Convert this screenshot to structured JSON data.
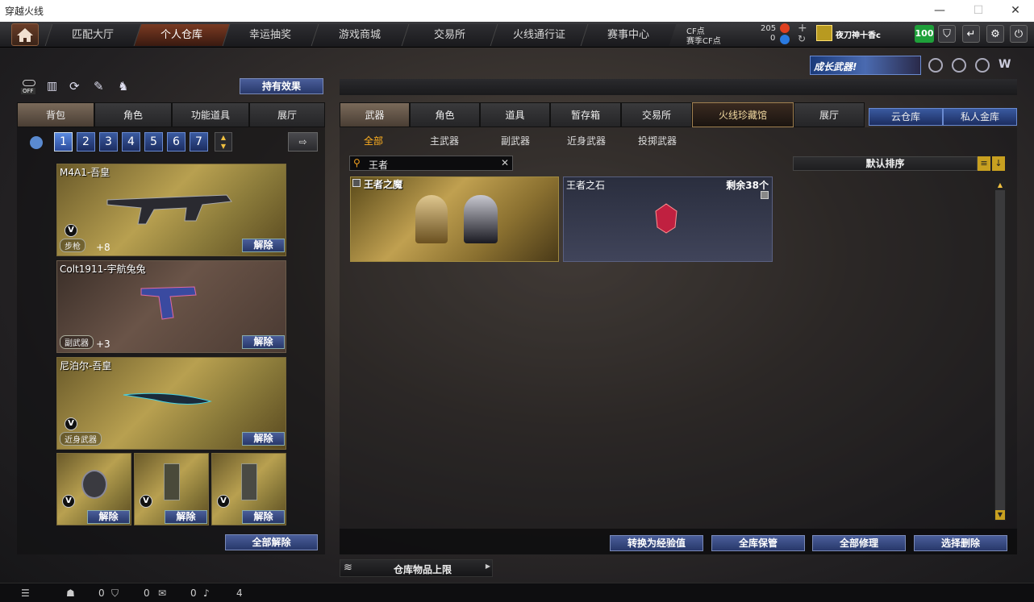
{
  "window": {
    "title": "穿越火线",
    "min": "—",
    "max": "☐",
    "close": "✕"
  },
  "nav": {
    "tabs": [
      "匹配大厅",
      "个人仓库",
      "幸运抽奖",
      "游戏商城",
      "交易所",
      "火线通行证",
      "赛事中心"
    ],
    "active": 1,
    "cf_label": "CF点",
    "cf_value": "205",
    "season_label": "赛季CF点",
    "season_value": "0",
    "username": "夜刀神十香c",
    "level": "100"
  },
  "banner": {
    "text": "成长武器!"
  },
  "left": {
    "effect_button": "持有效果",
    "tabs": [
      "背包",
      "角色",
      "功能道具",
      "展厅"
    ],
    "numbers": [
      "1",
      "2",
      "3",
      "4",
      "5",
      "6",
      "7"
    ],
    "slots": [
      {
        "name": "M4A1-吾皇",
        "tag": "步枪",
        "plus": "+8",
        "btn": "解除"
      },
      {
        "name": "Colt1911-宇航兔兔",
        "tag": "副武器",
        "plus": "+3",
        "btn": "解除"
      },
      {
        "name": "尼泊尔-吾皇",
        "tag": "近身武器",
        "plus": "",
        "btn": "解除"
      }
    ],
    "small_slots": [
      {
        "btn": "解除"
      },
      {
        "btn": "解除"
      },
      {
        "btn": "解除"
      }
    ],
    "unequip_all": "全部解除",
    "off_label": "OFF"
  },
  "right": {
    "tabs": [
      "武器",
      "角色",
      "道具",
      "暂存箱",
      "交易所",
      "火线珍藏馆",
      "展厅"
    ],
    "cloud": "云仓库",
    "private": "私人金库",
    "categories": [
      "全部",
      "主武器",
      "副武器",
      "近身武器",
      "投掷武器"
    ],
    "search_value": "王者",
    "sort_label": "默认排序",
    "items": [
      {
        "name": "王者之魔",
        "count": ""
      },
      {
        "name": "王者之石",
        "count": "剩余38个"
      }
    ],
    "buttons": [
      "转换为经验值",
      "全库保管",
      "全部修理",
      "选择删除"
    ],
    "limit": "仓库物品上限"
  },
  "status": {
    "v1": "0",
    "v2": "0",
    "v3": "0",
    "v4": "4"
  }
}
